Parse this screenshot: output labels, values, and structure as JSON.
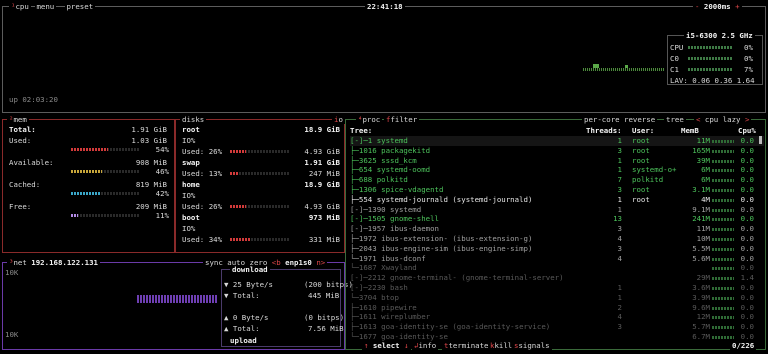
{
  "header": {
    "cpu": "cpu",
    "menu": "menu",
    "preset": "preset",
    "clock": "22:41:18",
    "refresh": "2000ms",
    "minus": "-",
    "plus": "+"
  },
  "cpu": {
    "model": "i5-6300",
    "freq": "2.5 GHz",
    "total_label": "CPU",
    "total_pct": "0%",
    "c0": "C0",
    "c0_pct": "0%",
    "c1": "C1",
    "c1_pct": "7%",
    "lav_label": "LAV:",
    "lav": "0.06 0.36 1.64",
    "uptime": "up 02:03:20"
  },
  "mem": {
    "title": "mem",
    "rows": [
      {
        "label": "Total:",
        "value": "1.91 GiB"
      },
      {
        "label": "Used:",
        "value": "1.03 GiB",
        "pct": "54%",
        "frac": 0.54
      },
      {
        "label": "Available:",
        "value": "908 MiB",
        "pct": "46%",
        "frac": 0.46
      },
      {
        "label": "Cached:",
        "value": "819 MiB",
        "pct": "42%",
        "frac": 0.42
      },
      {
        "label": "Free:",
        "value": "209 MiB",
        "pct": "11%",
        "frac": 0.11
      }
    ],
    "colors": {
      "used": "#d23a3a",
      "avail": "#c8a63a",
      "cached": "#3aa6c8",
      "free": "#b38ae6"
    }
  },
  "disks": {
    "title": "disks",
    "io": "io",
    "items": [
      {
        "name": "root",
        "total": "18.9 GiB",
        "io": "IO%",
        "used_pct": "Used: 26%",
        "used": "4.93 GiB",
        "frac": 0.26
      },
      {
        "name": "swap",
        "total": "1.91 GiB",
        "used_pct": "Used: 13%",
        "used": "247 MiB",
        "frac": 0.13
      },
      {
        "name": "home",
        "total": "18.9 GiB",
        "io": "IO%",
        "used_pct": "Used: 26%",
        "used": "4.93 GiB",
        "frac": 0.26
      },
      {
        "name": "boot",
        "total": "973 MiB",
        "io": "IO%",
        "used_pct": "Used: 34%",
        "used": "331 MiB",
        "frac": 0.34
      }
    ]
  },
  "net": {
    "title": "net",
    "ip": "192.168.122.131",
    "sync": "sync",
    "auto": "auto",
    "zero": "zero",
    "prev": "<b",
    "iface": "enp1s0",
    "next": "n>",
    "scale_top": "10K",
    "scale_bottom": "10K",
    "download": "download",
    "dl_rate": "▼ 25 Byte/s",
    "dl_bits": "(200 bitps)",
    "dl_total_label": "▼ Total:",
    "dl_total": "445 MiB",
    "ul_rate": "▲ 0 Byte/s",
    "ul_bits": "(0 bitps)",
    "ul_total_label": "▲ Total:",
    "ul_total": "7.56 MiB",
    "upload": "upload"
  },
  "proc": {
    "title": "proc",
    "filter": "filter",
    "per_core": "per-core",
    "reverse": "reverse",
    "tree": "tree",
    "sort": "cpu lazy",
    "cols": {
      "tree": "Tree:",
      "threads": "Threads:",
      "user": "User:",
      "mem": "MemB",
      "cpu": "Cpu%"
    },
    "rows": [
      {
        "tree": "[-]─1 systemd",
        "threads": "1",
        "user": "root",
        "mem": "11M",
        "cpu": "0.0",
        "c": "grn"
      },
      {
        "tree": "   ├─1016 packagekitd",
        "threads": "3",
        "user": "root",
        "mem": "165M",
        "cpu": "0.0",
        "c": "grn"
      },
      {
        "tree": "   ├─3625 sssd_kcm",
        "threads": "1",
        "user": "root",
        "mem": "39M",
        "cpu": "0.0",
        "c": "grn"
      },
      {
        "tree": "   ├─654 systemd-oomd",
        "threads": "1",
        "user": "systemd-o+",
        "mem": "6M",
        "cpu": "0.0",
        "c": "grn"
      },
      {
        "tree": "   ├─688 polkitd",
        "threads": "7",
        "user": "polkitd",
        "mem": "6M",
        "cpu": "0.0",
        "c": "grn"
      },
      {
        "tree": "   ├─1306 spice-vdagentd",
        "threads": "3",
        "user": "root",
        "mem": "3.1M",
        "cpu": "0.0",
        "c": "grn"
      },
      {
        "tree": "   ├─554 systemd-journald (systemd-journald)",
        "threads": "1",
        "user": "root",
        "mem": "4M",
        "cpu": "0.0",
        "c": "wh"
      },
      {
        "tree": "   [-]─1390 systemd",
        "threads": "1",
        "user": "",
        "mem": "9.1M",
        "cpu": "0.0",
        "c": "gr"
      },
      {
        "tree": "      [-]─1505 gnome-shell",
        "threads": "13",
        "user": "",
        "mem": "241M",
        "cpu": "0.0",
        "c": "grn"
      },
      {
        "tree": "         [-]─1957 ibus-daemon",
        "threads": "3",
        "user": "",
        "mem": "11M",
        "cpu": "0.0",
        "c": "gr"
      },
      {
        "tree": "            ├─1972 ibus-extension- (ibus-extension-g)",
        "threads": "4",
        "user": "",
        "mem": "10M",
        "cpu": "0.0",
        "c": "gr"
      },
      {
        "tree": "            ├─2043 ibus-engine-sim (ibus-engine-simp)",
        "threads": "3",
        "user": "",
        "mem": "5.5M",
        "cpu": "0.0",
        "c": "gr"
      },
      {
        "tree": "            └─1971 ibus-dconf",
        "threads": "4",
        "user": "",
        "mem": "5.6M",
        "cpu": "0.0",
        "c": "gr"
      },
      {
        "tree": "         └─1687 Xwayland",
        "threads": "",
        "user": "",
        "mem": "",
        "cpu": "0.0",
        "c": "dim"
      },
      {
        "tree": "      [-]─2212 gnome-terminal- (gnome-terminal-server)",
        "threads": "",
        "user": "",
        "mem": "29M",
        "cpu": "1.4",
        "c": "dim"
      },
      {
        "tree": "         [-]─2230 bash",
        "threads": "1",
        "user": "",
        "mem": "3.6M",
        "cpu": "0.0",
        "c": "dim"
      },
      {
        "tree": "            └─3704 btop",
        "threads": "1",
        "user": "",
        "mem": "3.9M",
        "cpu": "0.0",
        "c": "dim"
      },
      {
        "tree": "      ├─1610 pipewire",
        "threads": "2",
        "user": "",
        "mem": "9.6M",
        "cpu": "0.0",
        "c": "dim"
      },
      {
        "tree": "      ├─1611 wireplumber",
        "threads": "4",
        "user": "",
        "mem": "12M",
        "cpu": "0.0",
        "c": "dim"
      },
      {
        "tree": "      ├─1613 goa-identity-se (goa-identity-service)",
        "threads": "3",
        "user": "",
        "mem": "5.7M",
        "cpu": "0.0",
        "c": "dim"
      },
      {
        "tree": "      └─1677 goa-identity-se",
        "threads": "",
        "user": "",
        "mem": "6.7M",
        "cpu": "0.0",
        "c": "dim"
      }
    ],
    "footer": {
      "select": "select",
      "info": "info",
      "terminate": "terminate",
      "kill": "kill",
      "signals": "signals",
      "count": "0/226"
    }
  }
}
